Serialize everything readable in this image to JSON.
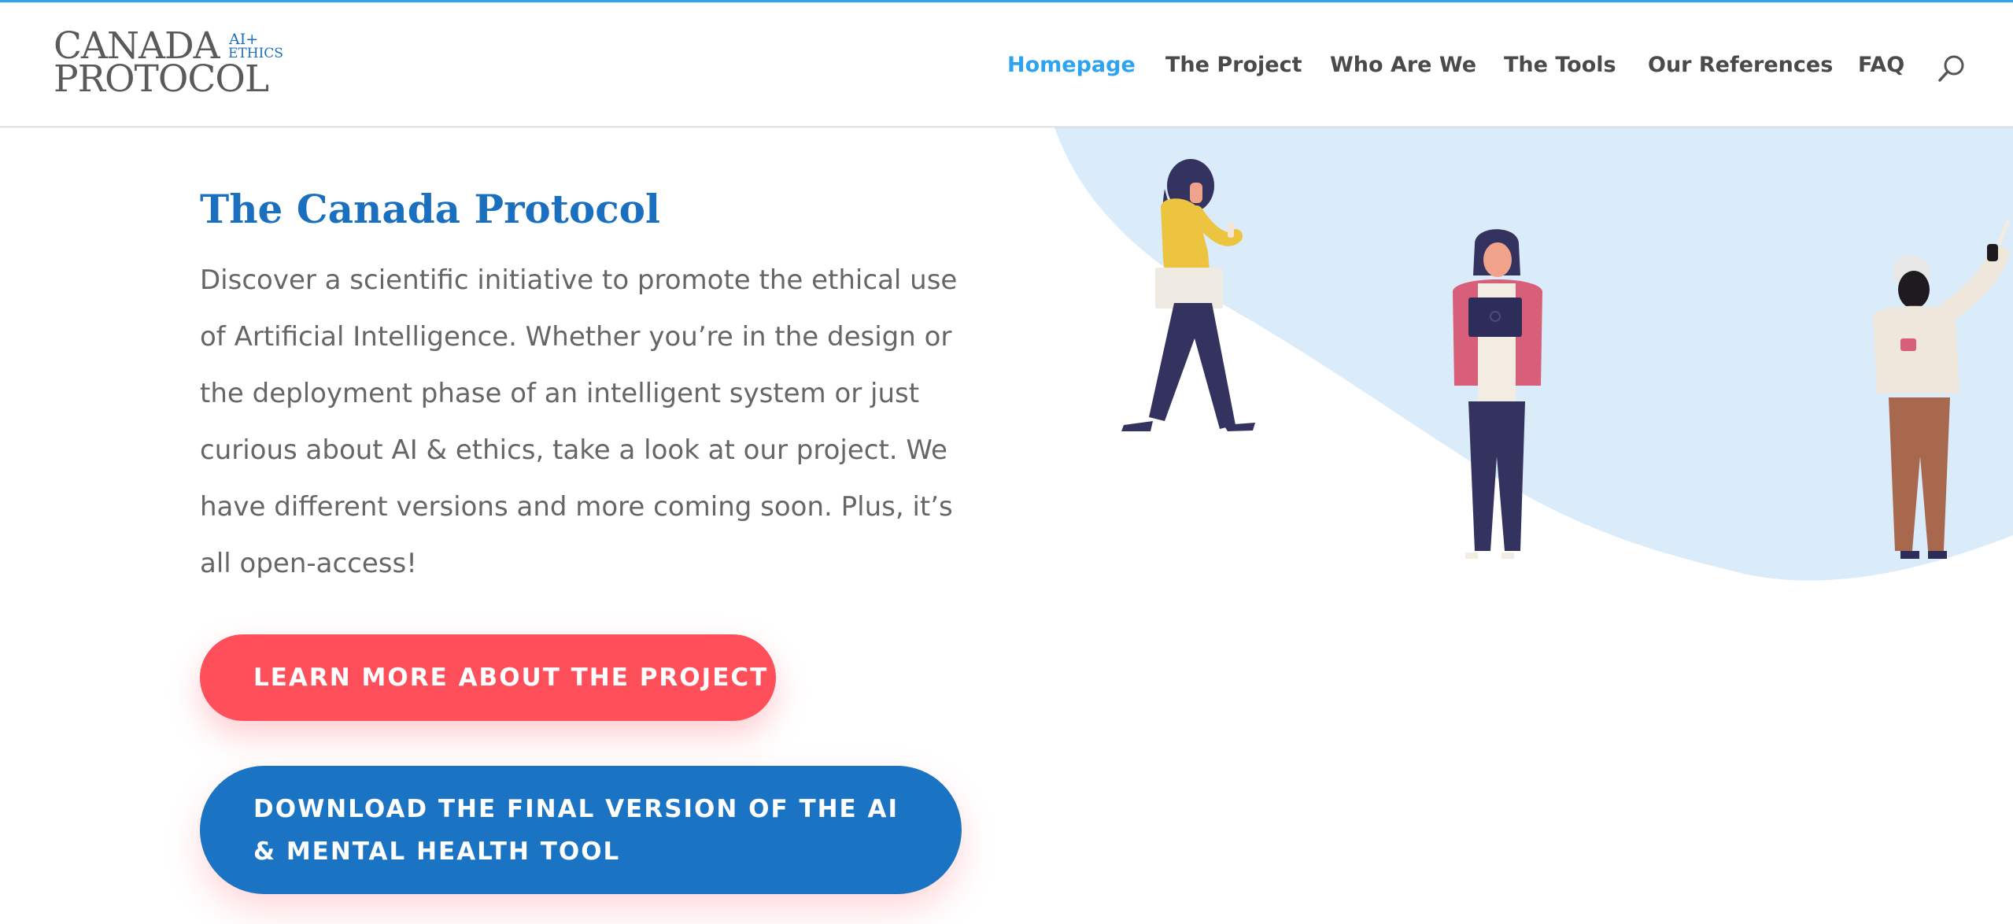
{
  "logo": {
    "line1": "CANADA",
    "line2": "PROTOCOL",
    "ai": "AI+",
    "ethics": "ETHICS"
  },
  "nav": {
    "items": [
      {
        "label": "Homepage",
        "active": true
      },
      {
        "label": "The Project",
        "active": false
      },
      {
        "label": "Who Are We",
        "active": false
      },
      {
        "label": "The Tools",
        "active": false
      },
      {
        "label": "Our References",
        "active": false
      },
      {
        "label": "FAQ",
        "active": false
      }
    ],
    "search_icon": "search-icon"
  },
  "hero": {
    "title": "The Canada Protocol",
    "intro": "Discover a scientific initiative to promote the ethical use of Artificial Intelligence. Whether you’re in the design or the deployment phase of an intelligent system or just curious about AI & ethics, take a look at our project. We have different versions and more coming soon. Plus, it’s all open-access!",
    "button_primary": "LEARN MORE ABOUT THE PROJECT",
    "button_secondary": "DOWNLOAD THE FINAL VERSION OF THE AI & MENTAL HEALTH TOOL"
  },
  "colors": {
    "accent": "#2ea3f2",
    "brand_blue": "#1a6fbf",
    "button_red": "#ff4f5a",
    "button_blue": "#1a73c3",
    "blob": "#daecfa"
  }
}
